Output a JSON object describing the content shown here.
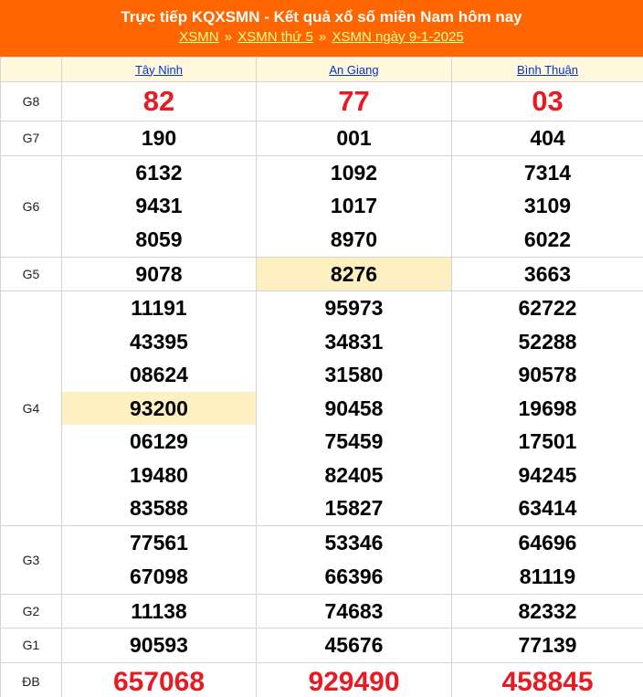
{
  "header": {
    "title": "Trực tiếp KQXSMN - Kết quả xổ số miền Nam hôm nay",
    "crumbs": [
      "XSMN",
      "XSMN thứ 5",
      "XSMN ngày 9-1-2025"
    ],
    "separator": "»"
  },
  "provinces": [
    "Tây Ninh",
    "An Giang",
    "Bình Thuận"
  ],
  "highlight_color": "#fff0c2",
  "accent_color": "#ff6600",
  "prize_number_color": "#e51c23",
  "prizes": [
    {
      "label": "G8",
      "values": [
        [
          "82"
        ],
        [
          "77"
        ],
        [
          "03"
        ]
      ]
    },
    {
      "label": "G7",
      "values": [
        [
          "190"
        ],
        [
          "001"
        ],
        [
          "404"
        ]
      ]
    },
    {
      "label": "G6",
      "values": [
        [
          "6132",
          "9431",
          "8059"
        ],
        [
          "1092",
          "1017",
          "8970"
        ],
        [
          "7314",
          "3109",
          "6022"
        ]
      ]
    },
    {
      "label": "G5",
      "values": [
        [
          "9078"
        ],
        [
          "8276"
        ],
        [
          "3663"
        ]
      ]
    },
    {
      "label": "G4",
      "values": [
        [
          "11191",
          "43395",
          "08624",
          "93200",
          "06129",
          "19480",
          "83588"
        ],
        [
          "95973",
          "34831",
          "31580",
          "90458",
          "75459",
          "82405",
          "15827"
        ],
        [
          "62722",
          "52288",
          "90578",
          "19698",
          "17501",
          "94245",
          "63414"
        ]
      ]
    },
    {
      "label": "G3",
      "values": [
        [
          "77561",
          "67098"
        ],
        [
          "53346",
          "66396"
        ],
        [
          "64696",
          "81119"
        ]
      ]
    },
    {
      "label": "G2",
      "values": [
        [
          "11138"
        ],
        [
          "74683"
        ],
        [
          "82332"
        ]
      ]
    },
    {
      "label": "G1",
      "values": [
        [
          "90593"
        ],
        [
          "45676"
        ],
        [
          "77139"
        ]
      ]
    },
    {
      "label": "ĐB",
      "values": [
        [
          "657068"
        ],
        [
          "929490"
        ],
        [
          "458845"
        ]
      ]
    }
  ]
}
